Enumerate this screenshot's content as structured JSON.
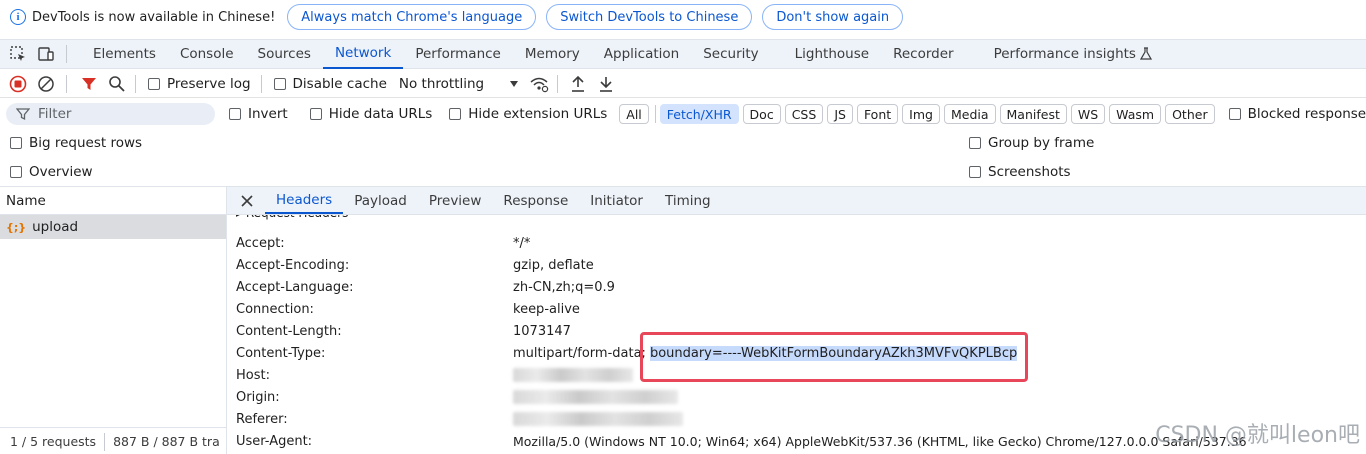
{
  "infobar": {
    "message": "DevTools is now available in Chinese!",
    "buttons": [
      "Always match Chrome's language",
      "Switch DevTools to Chinese",
      "Don't show again"
    ]
  },
  "main_tabs": [
    "Elements",
    "Console",
    "Sources",
    "Network",
    "Performance",
    "Memory",
    "Application",
    "Security",
    "Lighthouse",
    "Recorder",
    "Performance insights"
  ],
  "active_main_tab": "Network",
  "toolbar": {
    "preserve_log": "Preserve log",
    "disable_cache": "Disable cache",
    "throttling": "No throttling"
  },
  "filter": {
    "placeholder": "Filter",
    "invert": "Invert",
    "hide_data_urls": "Hide data URLs",
    "hide_extension_urls": "Hide extension URLs",
    "types": [
      "All",
      "Fetch/XHR",
      "Doc",
      "CSS",
      "JS",
      "Font",
      "Img",
      "Media",
      "Manifest",
      "WS",
      "Wasm",
      "Other"
    ],
    "active_type": "Fetch/XHR",
    "blocked_cookies": "Blocked response cookies"
  },
  "options": {
    "big_request_rows": "Big request rows",
    "overview": "Overview",
    "group_by_frame": "Group by frame",
    "screenshots": "Screenshots"
  },
  "request_list": {
    "column_name": "Name",
    "items": [
      {
        "name": "upload",
        "icon": "xhr-icon"
      }
    ],
    "status": "1 / 5 requests",
    "transfer": "887 B / 887 B tra"
  },
  "detail_tabs": [
    "Headers",
    "Payload",
    "Preview",
    "Response",
    "Initiator",
    "Timing"
  ],
  "active_detail_tab": "Headers",
  "request_headers": [
    {
      "name": "Accept:",
      "value": "*/*"
    },
    {
      "name": "Accept-Encoding:",
      "value": "gzip, deflate"
    },
    {
      "name": "Accept-Language:",
      "value": "zh-CN,zh;q=0.9"
    },
    {
      "name": "Connection:",
      "value": "keep-alive"
    },
    {
      "name": "Content-Length:",
      "value": "1073147"
    },
    {
      "name": "Content-Type:",
      "value": "multipart/form-data;",
      "highlight": "boundary=----WebKitFormBoundaryAZkh3MVFvQKPLBcp"
    },
    {
      "name": "Host:",
      "value": ""
    },
    {
      "name": "Origin:",
      "value": ""
    },
    {
      "name": "Referer:",
      "value": ""
    },
    {
      "name": "User-Agent:",
      "value": "Mozilla/5.0 (Windows NT 10.0; Win64; x64) AppleWebKit/537.36 (KHTML, like Gecko) Chrome/127.0.0.0 Safari/537.36"
    }
  ],
  "watermark": "CSDN @就叫leon吧",
  "colors": {
    "accent": "#0b57d0",
    "highlight_box": "#e8475a",
    "record_red": "#d93025"
  }
}
